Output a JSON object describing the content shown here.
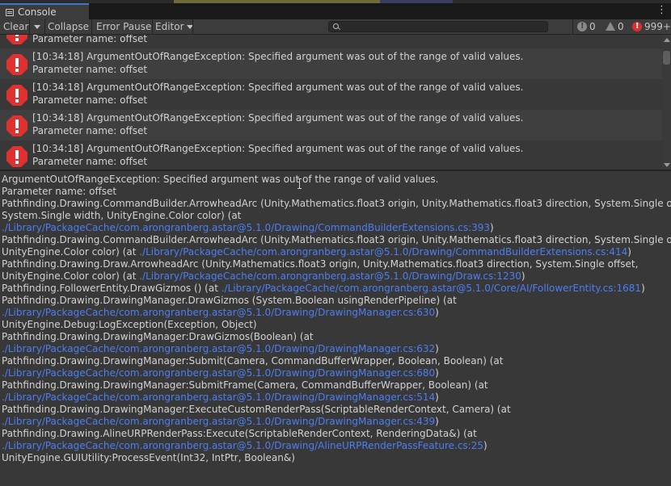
{
  "window": {
    "tab_title": "Console",
    "tab_icon": "console-icon",
    "menu_icon": "kebab-menu-icon"
  },
  "toolbar": {
    "clear_label": "Clear",
    "collapse_label": "Collapse",
    "error_pause_label": "Error Pause",
    "editor_label": "Editor",
    "search_value": "",
    "info_count": "0",
    "warning_count": "0",
    "error_count": "999+"
  },
  "colors": {
    "error_red": "#e03131",
    "link_blue": "#4c7ef2",
    "tab_accent": "#3d77c7"
  },
  "log": {
    "partial_row": {
      "line2": "Parameter name: offset"
    },
    "rows": [
      {
        "line1": "[10:34:18] ArgumentOutOfRangeException: Specified argument was out of the range of valid values.",
        "line2": "Parameter name: offset"
      },
      {
        "line1": "[10:34:18] ArgumentOutOfRangeException: Specified argument was out of the range of valid values.",
        "line2": "Parameter name: offset"
      },
      {
        "line1": "[10:34:18] ArgumentOutOfRangeException: Specified argument was out of the range of valid values.",
        "line2": "Parameter name: offset"
      },
      {
        "line1": "[10:34:18] ArgumentOutOfRangeException: Specified argument was out of the range of valid values.",
        "line2": "Parameter name: offset"
      }
    ]
  },
  "detail": {
    "lines": [
      {
        "text": "ArgumentOutOfRangeException: Specified argument was out of the range of valid values.",
        "link": ""
      },
      {
        "text": "Parameter name: offset",
        "link": ""
      },
      {
        "text": "Pathfinding.Drawing.CommandBuilder.ArrowheadArc (Unity.Mathematics.float3 origin, Unity.Mathematics.float3 direction, System.Single offset,",
        "link": ""
      },
      {
        "text": "System.Single width, UnityEngine.Color color) (at",
        "link": ""
      },
      {
        "text": "",
        "link": "./Library/PackageCache/com.arongranberg.astar@5.1.0/Drawing/CommandBuilderExtensions.cs:393",
        "after": ")"
      },
      {
        "text": "Pathfinding.Drawing.CommandBuilder.ArrowheadArc (Unity.Mathematics.float3 origin, Unity.Mathematics.float3 direction, System.Single offset,",
        "link": ""
      },
      {
        "text": "UnityEngine.Color color) (at ",
        "link": "./Library/PackageCache/com.arongranberg.astar@5.1.0/Drawing/CommandBuilderExtensions.cs:414",
        "after": ")"
      },
      {
        "text": "Pathfinding.Drawing.Draw.ArrowheadArc (Unity.Mathematics.float3 origin, Unity.Mathematics.float3 direction, System.Single offset,",
        "link": ""
      },
      {
        "text": "UnityEngine.Color color) (at ",
        "link": "./Library/PackageCache/com.arongranberg.astar@5.1.0/Drawing/Draw.cs:1230",
        "after": ")"
      },
      {
        "text": "Pathfinding.FollowerEntity.DrawGizmos () (at ",
        "link": "./Library/PackageCache/com.arongranberg.astar@5.1.0/Core/AI/FollowerEntity.cs:1681",
        "after": ")"
      },
      {
        "text": "Pathfinding.Drawing.DrawingManager.DrawGizmos (System.Boolean usingRenderPipeline) (at",
        "link": ""
      },
      {
        "text": "",
        "link": "./Library/PackageCache/com.arongranberg.astar@5.1.0/Drawing/DrawingManager.cs:630",
        "after": ")"
      },
      {
        "text": "UnityEngine.Debug:LogException(Exception, Object)",
        "link": ""
      },
      {
        "text": "Pathfinding.Drawing.DrawingManager:DrawGizmos(Boolean) (at",
        "link": ""
      },
      {
        "text": "",
        "link": "./Library/PackageCache/com.arongranberg.astar@5.1.0/Drawing/DrawingManager.cs:632",
        "after": ")"
      },
      {
        "text": "Pathfinding.Drawing.DrawingManager:Submit(Camera, CommandBufferWrapper, Boolean, Boolean) (at",
        "link": ""
      },
      {
        "text": "",
        "link": "./Library/PackageCache/com.arongranberg.astar@5.1.0/Drawing/DrawingManager.cs:680",
        "after": ")"
      },
      {
        "text": "Pathfinding.Drawing.DrawingManager:SubmitFrame(Camera, CommandBufferWrapper, Boolean) (at",
        "link": ""
      },
      {
        "text": "",
        "link": "./Library/PackageCache/com.arongranberg.astar@5.1.0/Drawing/DrawingManager.cs:514",
        "after": ")"
      },
      {
        "text": "Pathfinding.Drawing.DrawingManager:ExecuteCustomRenderPass(ScriptableRenderContext, Camera) (at",
        "link": ""
      },
      {
        "text": "",
        "link": "./Library/PackageCache/com.arongranberg.astar@5.1.0/Drawing/DrawingManager.cs:439",
        "after": ")"
      },
      {
        "text": "Pathfinding.Drawing.AlineURPRenderPass:Execute(ScriptableRenderContext, RenderingData&) (at",
        "link": ""
      },
      {
        "text": "",
        "link": "./Library/PackageCache/com.arongranberg.astar@5.1.0/Drawing/AlineURPRenderPassFeature.cs:25",
        "after": ")"
      },
      {
        "text": "UnityEngine.GUIUtility:ProcessEvent(Int32, IntPtr, Boolean&)",
        "link": ""
      }
    ]
  }
}
